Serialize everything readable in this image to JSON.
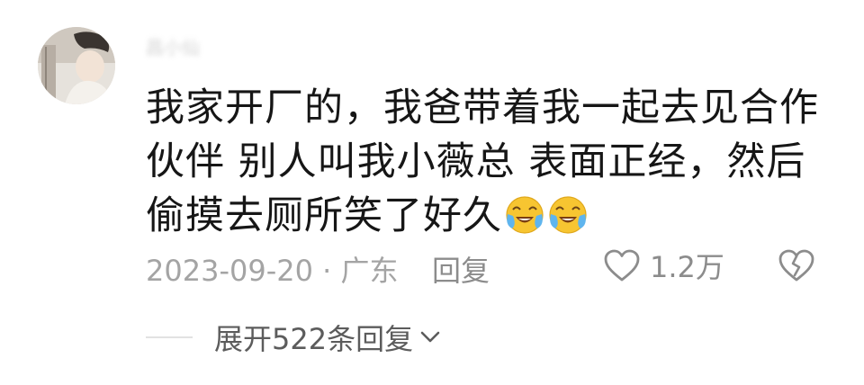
{
  "comment": {
    "username": "昌小仙",
    "text": "我家开厂的，我爸带着我一起去见合作伙伴 别人叫我小薇总 表面正经，然后偷摸去厕所笑了好久",
    "emojis": [
      "laugh-cry-emoji",
      "laugh-cry-emoji"
    ],
    "timestamp": "2023-09-20 · 广东",
    "reply_label": "回复",
    "like_count": "1.2万",
    "icons": {
      "like": "heart-outline-icon",
      "dislike": "broken-heart-icon"
    },
    "colors": {
      "text": "#161616",
      "meta": "#a4a4a4",
      "secondary": "#8c8c8c",
      "emoji_face": "#f7c531",
      "emoji_tear": "#5fb5ee"
    }
  },
  "replies": {
    "expand_label": "展开522条回复"
  }
}
